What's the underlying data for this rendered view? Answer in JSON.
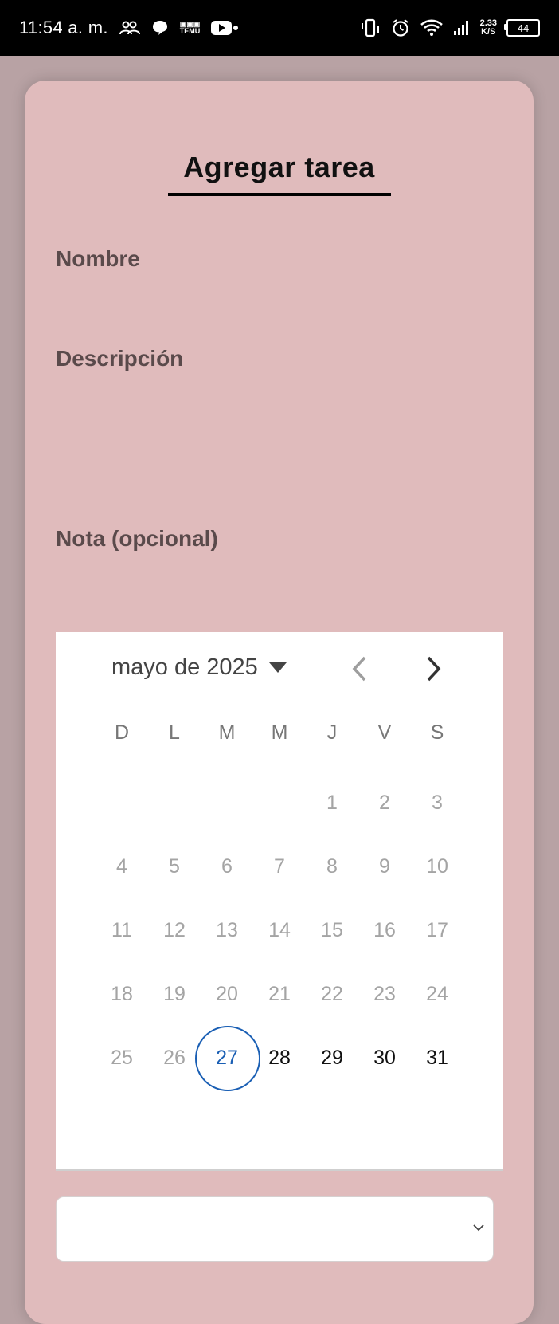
{
  "status_bar": {
    "time": "11:54 a. m.",
    "notif_icons": [
      "people-icon",
      "chat-bubble-icon",
      "temu-icon",
      "youtube-icon"
    ],
    "temu_label_top": "▣▣▣",
    "temu_label": "TEMU",
    "net_speed_value": "2.33",
    "net_speed_unit": "K/S",
    "battery_level": "44",
    "right_icons": [
      "vibrate-icon",
      "alarm-icon",
      "wifi-icon",
      "signal-icon"
    ]
  },
  "form": {
    "title": "Agregar tarea",
    "name_label": "Nombre",
    "name_value": "",
    "description_label": "Descripción",
    "description_value": "",
    "note_label": "Nota (opcional)",
    "note_value": ""
  },
  "calendar": {
    "month_label": "mayo de 2025",
    "weekdays": [
      "D",
      "L",
      "M",
      "M",
      "J",
      "V",
      "S"
    ],
    "weeks": [
      [
        "",
        "",
        "",
        "",
        "1",
        "2",
        "3"
      ],
      [
        "4",
        "5",
        "6",
        "7",
        "8",
        "9",
        "10"
      ],
      [
        "11",
        "12",
        "13",
        "14",
        "15",
        "16",
        "17"
      ],
      [
        "18",
        "19",
        "20",
        "21",
        "22",
        "23",
        "24"
      ],
      [
        "25",
        "26",
        "27",
        "28",
        "29",
        "30",
        "31"
      ]
    ],
    "today": "27",
    "first_enabled_day": 28,
    "accent_color": "#1a5fb4"
  },
  "select": {
    "value": "",
    "icon": "chevron-down-icon"
  },
  "colors": {
    "background": "#b8a2a4",
    "card": "#e0bbbc",
    "label": "#5a4a4b"
  }
}
